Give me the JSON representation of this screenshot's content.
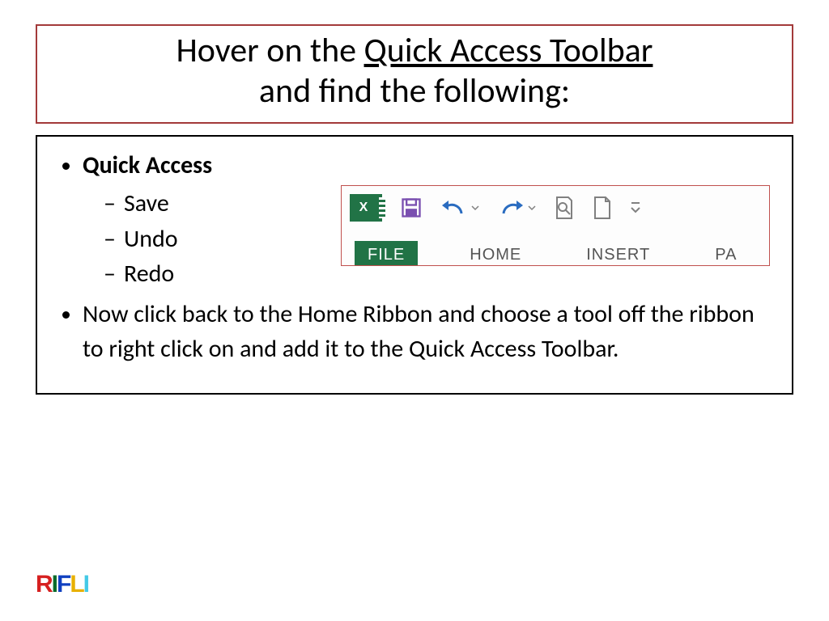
{
  "title": {
    "prefix": "Hover on the ",
    "underlined": "Quick Access Toolbar",
    "line2": "and find the following:"
  },
  "body": {
    "heading": "Quick Access",
    "sub_items": [
      "Save",
      "Undo",
      "Redo"
    ],
    "instruction": "Now click back to the Home Ribbon and choose a tool off the ribbon to right click on and add it to the Quick Access Toolbar."
  },
  "ribbon": {
    "app_letter": "X",
    "tabs": [
      "FILE",
      "HOME",
      "INSERT",
      "PA"
    ],
    "active_tab_index": 0
  },
  "logo": {
    "letters": [
      "R",
      "I",
      "F",
      "L",
      "I"
    ]
  },
  "colors": {
    "excel_green": "#217346",
    "title_border": "#a33a3a",
    "ribbon_border": "#c0504d",
    "undo_redo_blue": "#2a6cc0",
    "save_purple": "#7a4fb0",
    "icon_gray": "#808080"
  }
}
